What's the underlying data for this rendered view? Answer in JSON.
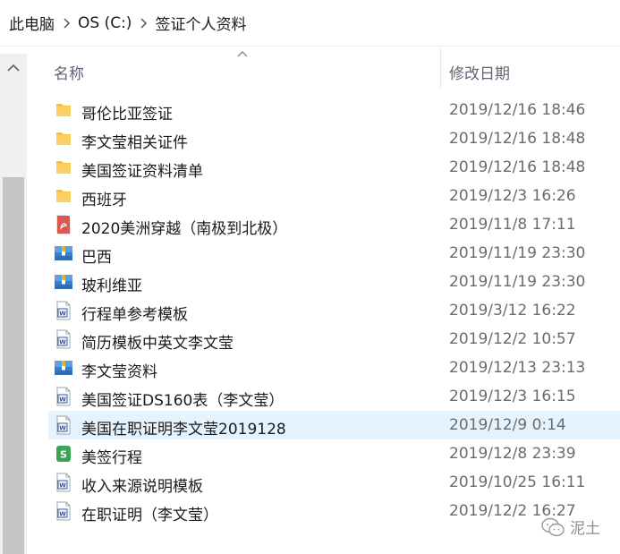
{
  "breadcrumb": {
    "items": [
      "此电脑",
      "OS (C:)",
      "签证个人资料"
    ]
  },
  "columns": {
    "name": "名称",
    "date_modified": "修改日期"
  },
  "files": [
    {
      "name": "哥伦比亚签证",
      "date": "2019/12/16 18:46",
      "icon": "folder-icon"
    },
    {
      "name": "李文莹相关证件",
      "date": "2019/12/16 18:48",
      "icon": "folder-icon"
    },
    {
      "name": "美国签证资料清单",
      "date": "2019/12/16 18:48",
      "icon": "folder-icon"
    },
    {
      "name": "西班牙",
      "date": "2019/12/3 16:26",
      "icon": "folder-icon"
    },
    {
      "name": "2020美洲穿越（南极到北极）",
      "date": "2019/11/8 17:11",
      "icon": "pdf-icon"
    },
    {
      "name": "巴西",
      "date": "2019/11/19 23:30",
      "icon": "archive-icon"
    },
    {
      "name": "玻利维亚",
      "date": "2019/11/19 23:30",
      "icon": "archive-icon"
    },
    {
      "name": "行程单参考模板",
      "date": "2019/3/12 16:22",
      "icon": "word-doc-icon"
    },
    {
      "name": "简历模板中英文李文莹",
      "date": "2019/12/2 10:57",
      "icon": "word-doc-icon"
    },
    {
      "name": "李文莹资料",
      "date": "2019/12/13 23:13",
      "icon": "archive-icon"
    },
    {
      "name": "美国签证DS160表（李文莹）",
      "date": "2019/12/3 16:15",
      "icon": "word-doc-icon"
    },
    {
      "name": "美国在职证明李文莹2019128",
      "date": "2019/12/9 0:14",
      "icon": "word-doc-icon",
      "selected": true
    },
    {
      "name": "美签行程",
      "date": "2019/12/8 23:39",
      "icon": "spreadsheet-icon"
    },
    {
      "name": "收入来源说明模板",
      "date": "2019/10/25 16:11",
      "icon": "word-doc-icon"
    },
    {
      "name": "在职证明（李文莹）",
      "date": "2019/12/2 16:27",
      "icon": "word-doc-icon"
    }
  ],
  "watermark": {
    "text": "泥土",
    "icon": "wechat-icon"
  },
  "colors": {
    "folder": "#f4c14b",
    "selected_row": "#e5f3ff",
    "header_text": "#5d6675",
    "date_text": "#6b6b6b",
    "word_blue": "#2b5797",
    "spreadsheet_green": "#3aa655",
    "pdf_red": "#d9413a"
  }
}
